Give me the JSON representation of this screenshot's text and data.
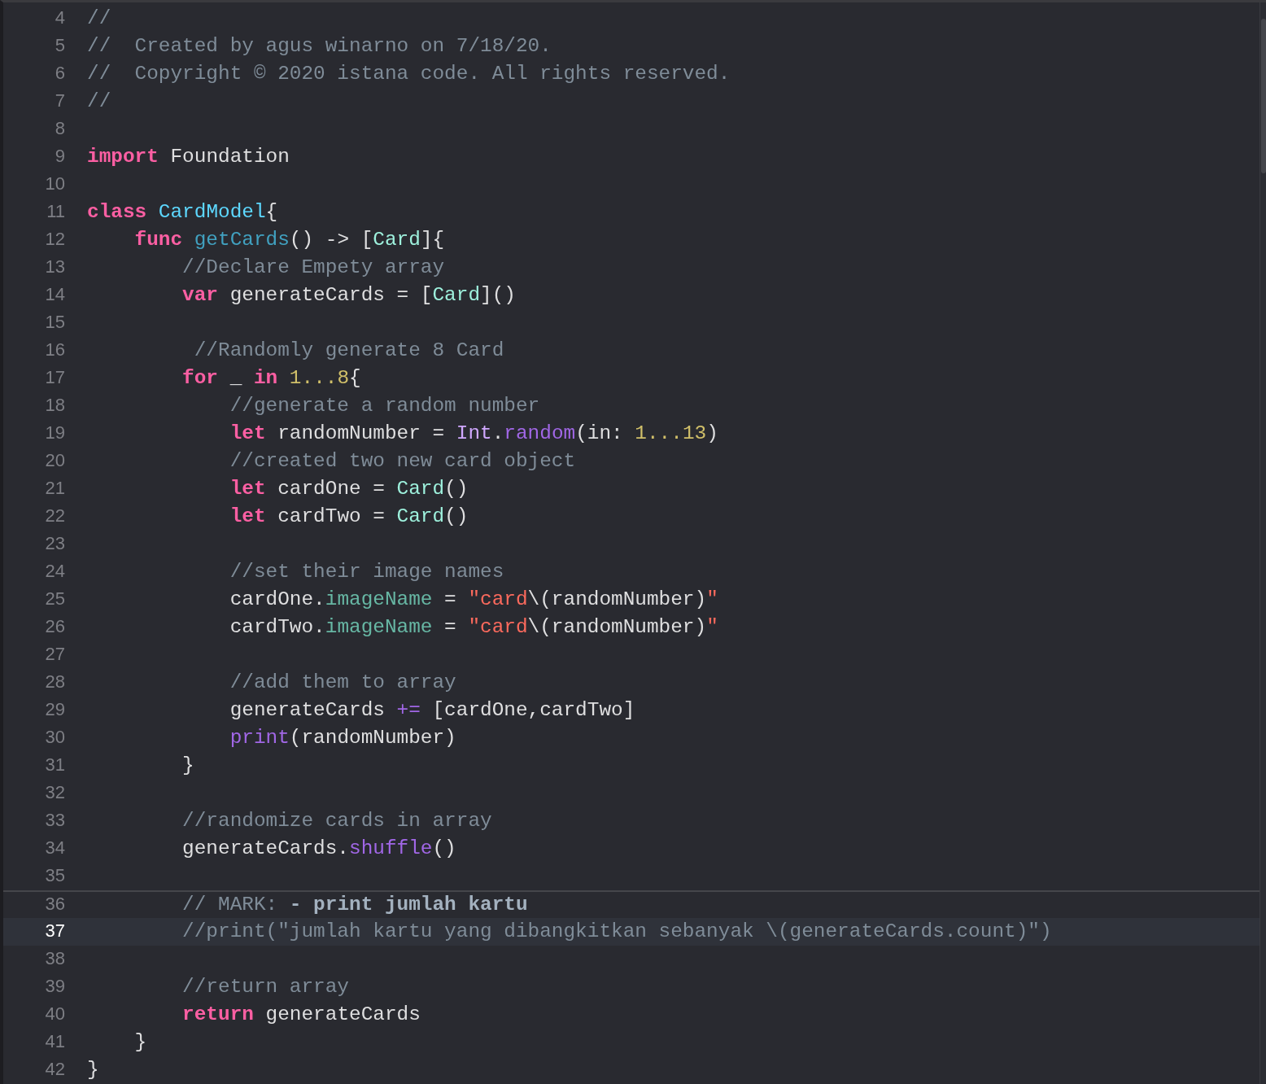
{
  "editor": {
    "lines": [
      {
        "number": "4",
        "current": false,
        "divider": false,
        "tokens": [
          {
            "kind": "comment",
            "text": "//"
          }
        ]
      },
      {
        "number": "5",
        "current": false,
        "divider": false,
        "tokens": [
          {
            "kind": "comment",
            "text": "//  Created by agus winarno on 7/18/20."
          }
        ]
      },
      {
        "number": "6",
        "current": false,
        "divider": false,
        "tokens": [
          {
            "kind": "comment",
            "text": "//  Copyright © 2020 istana code. All rights reserved."
          }
        ]
      },
      {
        "number": "7",
        "current": false,
        "divider": false,
        "tokens": [
          {
            "kind": "comment",
            "text": "//"
          }
        ]
      },
      {
        "number": "8",
        "current": false,
        "divider": false
      },
      {
        "number": "9",
        "current": false,
        "divider": false,
        "tokens": [
          {
            "kind": "keyword",
            "text": "import"
          },
          {
            "kind": "plain",
            "text": " Foundation"
          }
        ]
      },
      {
        "number": "10",
        "current": false,
        "divider": false
      },
      {
        "number": "11",
        "current": false,
        "divider": false,
        "tokens": [
          {
            "kind": "keyword",
            "text": "class "
          },
          {
            "kind": "class_name",
            "text": "CardModel"
          },
          {
            "kind": "plain",
            "text": "{"
          }
        ]
      },
      {
        "number": "12",
        "current": false,
        "divider": false,
        "tokens": [
          {
            "kind": "keyword",
            "text": "    func "
          },
          {
            "kind": "func_name",
            "text": "getCards"
          },
          {
            "kind": "plain",
            "text": "() -> ["
          },
          {
            "kind": "type",
            "text": "Card"
          },
          {
            "kind": "plain",
            "text": "]{"
          }
        ]
      },
      {
        "number": "13",
        "current": false,
        "divider": false,
        "tokens": [
          {
            "kind": "comment",
            "text": "        //Declare Empety array"
          }
        ]
      },
      {
        "number": "14",
        "current": false,
        "divider": false,
        "tokens": [
          {
            "kind": "keyword",
            "text": "        var"
          },
          {
            "kind": "plain",
            "text": " generateCards = ["
          },
          {
            "kind": "type",
            "text": "Card"
          },
          {
            "kind": "plain",
            "text": "]()"
          }
        ]
      },
      {
        "number": "15",
        "current": false,
        "divider": false
      },
      {
        "number": "16",
        "current": false,
        "divider": false,
        "tokens": [
          {
            "kind": "comment",
            "text": "         //Randomly generate 8 Card"
          }
        ]
      },
      {
        "number": "17",
        "current": false,
        "divider": false,
        "tokens": [
          {
            "kind": "keyword",
            "text": "        for"
          },
          {
            "kind": "plain",
            "text": " _ "
          },
          {
            "kind": "keyword",
            "text": "in "
          },
          {
            "kind": "number",
            "text": "1...8"
          },
          {
            "kind": "plain",
            "text": "{"
          }
        ]
      },
      {
        "number": "18",
        "current": false,
        "divider": false,
        "tokens": [
          {
            "kind": "comment",
            "text": "            //generate a random number"
          }
        ]
      },
      {
        "number": "19",
        "current": false,
        "divider": false,
        "tokens": [
          {
            "kind": "keyword",
            "text": "            let"
          },
          {
            "kind": "plain",
            "text": " randomNumber = "
          },
          {
            "kind": "system_type",
            "text": "Int"
          },
          {
            "kind": "plain",
            "text": "."
          },
          {
            "kind": "method",
            "text": "random"
          },
          {
            "kind": "plain",
            "text": "(in: "
          },
          {
            "kind": "number",
            "text": "1...13"
          },
          {
            "kind": "plain",
            "text": ")"
          }
        ]
      },
      {
        "number": "20",
        "current": false,
        "divider": false,
        "tokens": [
          {
            "kind": "comment",
            "text": "            //created two new card object"
          }
        ]
      },
      {
        "number": "21",
        "current": false,
        "divider": false,
        "tokens": [
          {
            "kind": "keyword",
            "text": "            let"
          },
          {
            "kind": "plain",
            "text": " cardOne = "
          },
          {
            "kind": "type",
            "text": "Card"
          },
          {
            "kind": "plain",
            "text": "()"
          }
        ]
      },
      {
        "number": "22",
        "current": false,
        "divider": false,
        "tokens": [
          {
            "kind": "keyword",
            "text": "            let"
          },
          {
            "kind": "plain",
            "text": " cardTwo = "
          },
          {
            "kind": "type",
            "text": "Card"
          },
          {
            "kind": "plain",
            "text": "()"
          }
        ]
      },
      {
        "number": "23",
        "current": false,
        "divider": false
      },
      {
        "number": "24",
        "current": false,
        "divider": false,
        "tokens": [
          {
            "kind": "comment",
            "text": "            //set their image names"
          }
        ]
      },
      {
        "number": "25",
        "current": false,
        "divider": false,
        "tokens": [
          {
            "kind": "plain",
            "text": "            cardOne."
          },
          {
            "kind": "property",
            "text": "imageName"
          },
          {
            "kind": "plain",
            "text": " = "
          },
          {
            "kind": "string",
            "text": "\"card"
          },
          {
            "kind": "plain",
            "text": "\\(randomNumber)"
          },
          {
            "kind": "string",
            "text": "\""
          }
        ]
      },
      {
        "number": "26",
        "current": false,
        "divider": false,
        "tokens": [
          {
            "kind": "plain",
            "text": "            cardTwo."
          },
          {
            "kind": "property",
            "text": "imageName"
          },
          {
            "kind": "plain",
            "text": " = "
          },
          {
            "kind": "string",
            "text": "\"card"
          },
          {
            "kind": "plain",
            "text": "\\(randomNumber)"
          },
          {
            "kind": "string",
            "text": "\""
          }
        ]
      },
      {
        "number": "27",
        "current": false,
        "divider": false
      },
      {
        "number": "28",
        "current": false,
        "divider": false,
        "tokens": [
          {
            "kind": "comment",
            "text": "            //add them to array"
          }
        ]
      },
      {
        "number": "29",
        "current": false,
        "divider": false,
        "tokens": [
          {
            "kind": "plain",
            "text": "            generateCards "
          },
          {
            "kind": "method",
            "text": "+="
          },
          {
            "kind": "plain",
            "text": " [cardOne,cardTwo]"
          }
        ]
      },
      {
        "number": "30",
        "current": false,
        "divider": false,
        "tokens": [
          {
            "kind": "method",
            "text": "            print"
          },
          {
            "kind": "plain",
            "text": "(randomNumber)"
          }
        ]
      },
      {
        "number": "31",
        "current": false,
        "divider": false,
        "tokens": [
          {
            "kind": "plain",
            "text": "        }"
          }
        ]
      },
      {
        "number": "32",
        "current": false,
        "divider": false
      },
      {
        "number": "33",
        "current": false,
        "divider": false,
        "tokens": [
          {
            "kind": "comment",
            "text": "        //randomize cards in array"
          }
        ]
      },
      {
        "number": "34",
        "current": false,
        "divider": false,
        "tokens": [
          {
            "kind": "plain",
            "text": "        generateCards."
          },
          {
            "kind": "method",
            "text": "shuffle"
          },
          {
            "kind": "plain",
            "text": "()"
          }
        ]
      },
      {
        "number": "35",
        "current": false,
        "divider": false
      },
      {
        "number": "36",
        "current": false,
        "divider": true,
        "tokens": [
          {
            "kind": "comment",
            "text": "        // MARK: "
          },
          {
            "kind": "mark",
            "text": "- print jumlah kartu"
          }
        ]
      },
      {
        "number": "37",
        "current": true,
        "divider": false,
        "tokens": [
          {
            "kind": "comment",
            "text": "        //print(\"jumlah kartu yang dibangkitkan sebanyak \\(generateCards.count)\")"
          }
        ]
      },
      {
        "number": "38",
        "current": false,
        "divider": false
      },
      {
        "number": "39",
        "current": false,
        "divider": false,
        "tokens": [
          {
            "kind": "comment",
            "text": "        //return array"
          }
        ]
      },
      {
        "number": "40",
        "current": false,
        "divider": false,
        "tokens": [
          {
            "kind": "keyword",
            "text": "        return"
          },
          {
            "kind": "plain",
            "text": " generateCards"
          }
        ]
      },
      {
        "number": "41",
        "current": false,
        "divider": false,
        "tokens": [
          {
            "kind": "plain",
            "text": "    }"
          }
        ]
      },
      {
        "number": "42",
        "current": false,
        "divider": false,
        "tokens": [
          {
            "kind": "plain",
            "text": "}"
          }
        ]
      }
    ]
  }
}
